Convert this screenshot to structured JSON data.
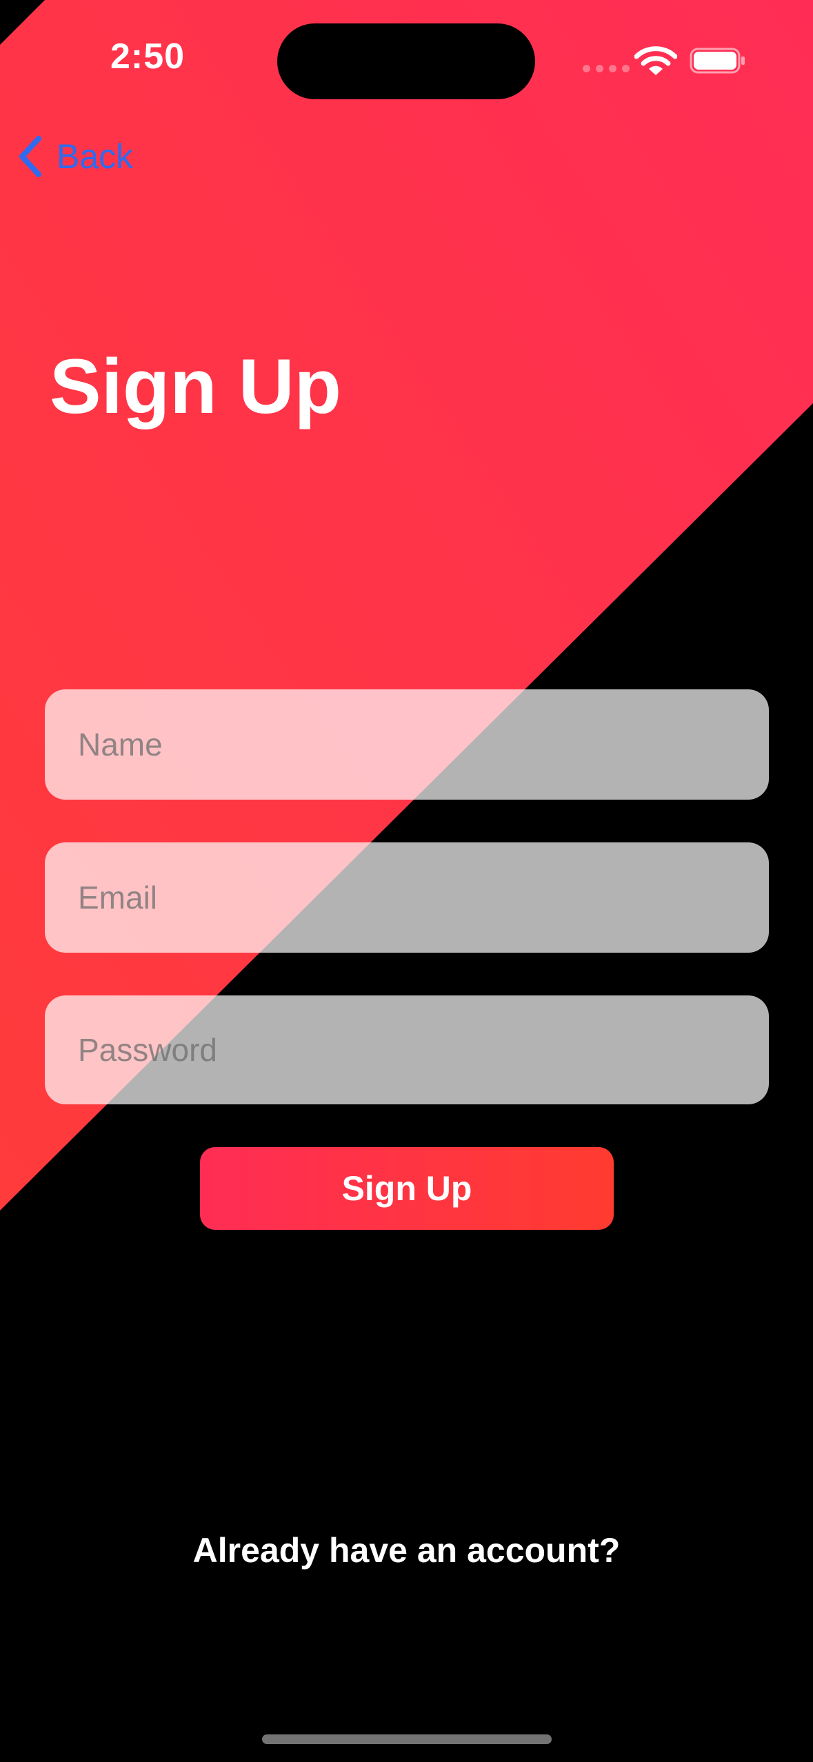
{
  "status_bar": {
    "time": "2:50"
  },
  "nav": {
    "back_label": "Back"
  },
  "title": "Sign Up",
  "form": {
    "name_placeholder": "Name",
    "email_placeholder": "Email",
    "password_placeholder": "Password",
    "name_value": "",
    "email_value": "",
    "password_value": "",
    "submit_label": "Sign Up"
  },
  "footer": {
    "login_prompt": "Already have an account?"
  },
  "icons": {
    "back": "chevron-left-icon",
    "wifi": "wifi-icon",
    "battery": "battery-icon",
    "signal": "cellular-signal-icon"
  },
  "colors": {
    "background": "#000000",
    "gradient_start": "#ff3b3b",
    "gradient_end": "#ff2d55",
    "accent_link": "#2e6bf0",
    "button_start": "#ff2d55",
    "button_end": "#ff3b30"
  }
}
